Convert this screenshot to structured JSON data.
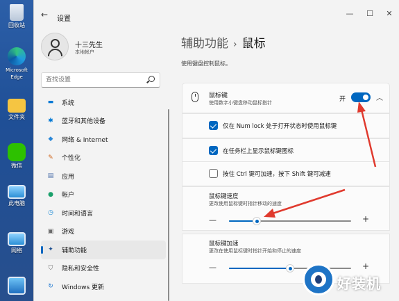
{
  "desktop": {
    "icons": [
      {
        "label": "回收站",
        "icon": "recycle-bin-icon"
      },
      {
        "label": "Microsoft Edge",
        "icon": "edge-icon"
      },
      {
        "label": "文件夹",
        "icon": "folder-icon"
      },
      {
        "label": "微信",
        "icon": "wechat-icon"
      },
      {
        "label": "此电脑",
        "icon": "computer-icon"
      },
      {
        "label": "网络",
        "icon": "network-icon"
      },
      {
        "label": "",
        "icon": "control-panel-icon"
      }
    ]
  },
  "window": {
    "title": "设置",
    "back_icon": "←",
    "controls": {
      "minimize": "—",
      "maximize": "☐",
      "close": "✕"
    }
  },
  "profile": {
    "name": "十三先生",
    "account": "本地帐户"
  },
  "search": {
    "placeholder": "查找设置"
  },
  "nav": {
    "items": [
      {
        "label": "系统",
        "icon": "system-icon",
        "color": "#0078d4",
        "glyph": "▬"
      },
      {
        "label": "蓝牙和其他设备",
        "icon": "bluetooth-icon",
        "color": "#0078d4",
        "glyph": "✱"
      },
      {
        "label": "网络 & Internet",
        "icon": "wifi-icon",
        "color": "#2b88d8",
        "glyph": "◆"
      },
      {
        "label": "个性化",
        "icon": "brush-icon",
        "color": "#d0651b",
        "glyph": "✎"
      },
      {
        "label": "应用",
        "icon": "apps-icon",
        "color": "#4a6ea8",
        "glyph": "▤"
      },
      {
        "label": "帐户",
        "icon": "account-icon",
        "color": "#1aa06b",
        "glyph": "●"
      },
      {
        "label": "时间和语言",
        "icon": "globe-clock-icon",
        "color": "#1f8bd6",
        "glyph": "◷"
      },
      {
        "label": "游戏",
        "icon": "game-icon",
        "color": "#6b6b6b",
        "glyph": "▣"
      },
      {
        "label": "辅助功能",
        "icon": "accessibility-icon",
        "color": "#1a4d8f",
        "glyph": "✦",
        "selected": true
      },
      {
        "label": "隐私和安全性",
        "icon": "shield-icon",
        "color": "#6b6b6b",
        "glyph": "⛉"
      },
      {
        "label": "Windows 更新",
        "icon": "update-icon",
        "color": "#1f78d1",
        "glyph": "↻"
      }
    ]
  },
  "content": {
    "breadcrumb": {
      "parent": "辅助功能",
      "separator": "›",
      "current": "鼠标"
    },
    "description": "使用键盘控制鼠标。",
    "mouse_keys": {
      "title": "鼠标键",
      "subtitle": "使用数字小键盘移动鼠标指针",
      "toggle_label": "开",
      "toggle_on": true,
      "expand_icon": "︿"
    },
    "options": [
      {
        "label": "仅在 Num lock 处于打开状态时使用鼠标键",
        "checked": true
      },
      {
        "label": "在任务栏上显示鼠标键图标",
        "checked": true
      },
      {
        "label": "按住 Ctrl 键可加速，按下 Shift 键可减速",
        "checked": false
      }
    ],
    "speed": {
      "title": "鼠标键速度",
      "subtitle": "更改使用鼠标键时指针移动的速度",
      "value_fraction": 0.23,
      "minus": "—",
      "plus": "+"
    },
    "acceleration": {
      "title": "鼠标键加速",
      "subtitle": "更改在使用鼠标键时指针开始和停止的速度",
      "value_fraction": 0.5,
      "minus": "—",
      "plus": "+"
    }
  },
  "watermark": {
    "text": "好装机"
  },
  "colors": {
    "accent": "#0067c0",
    "annotation": "#e03a2e"
  }
}
